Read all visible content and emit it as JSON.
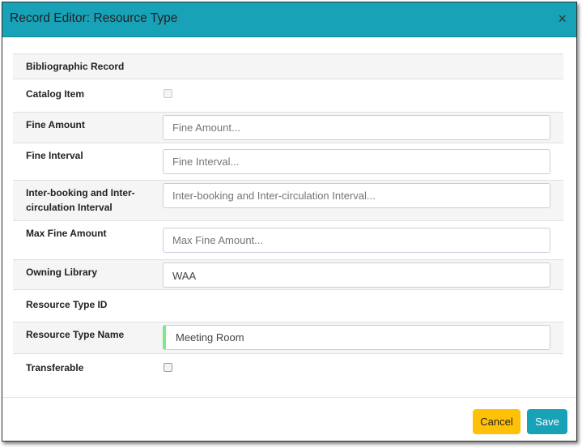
{
  "dialog": {
    "title": "Record Editor: Resource Type",
    "close_icon": "×"
  },
  "fields": [
    {
      "label": "Bibliographic Record"
    },
    {
      "label": "Catalog Item",
      "checked": false
    },
    {
      "label": "Fine Amount",
      "placeholder": "Fine Amount..."
    },
    {
      "label": "Fine Interval",
      "placeholder": "Fine Interval..."
    },
    {
      "label": "Inter-booking and Inter-circulation Interval",
      "placeholder": "Inter-booking and Inter-circulation Interval..."
    },
    {
      "label": "Max Fine Amount",
      "placeholder": "Max Fine Amount..."
    },
    {
      "label": "Owning Library",
      "value": "WAA"
    },
    {
      "label": "Resource Type ID"
    },
    {
      "label": "Resource Type Name",
      "value": "Meeting Room"
    },
    {
      "label": "Transferable",
      "checked": false
    }
  ],
  "footer": {
    "cancel": "Cancel",
    "save": "Save"
  }
}
